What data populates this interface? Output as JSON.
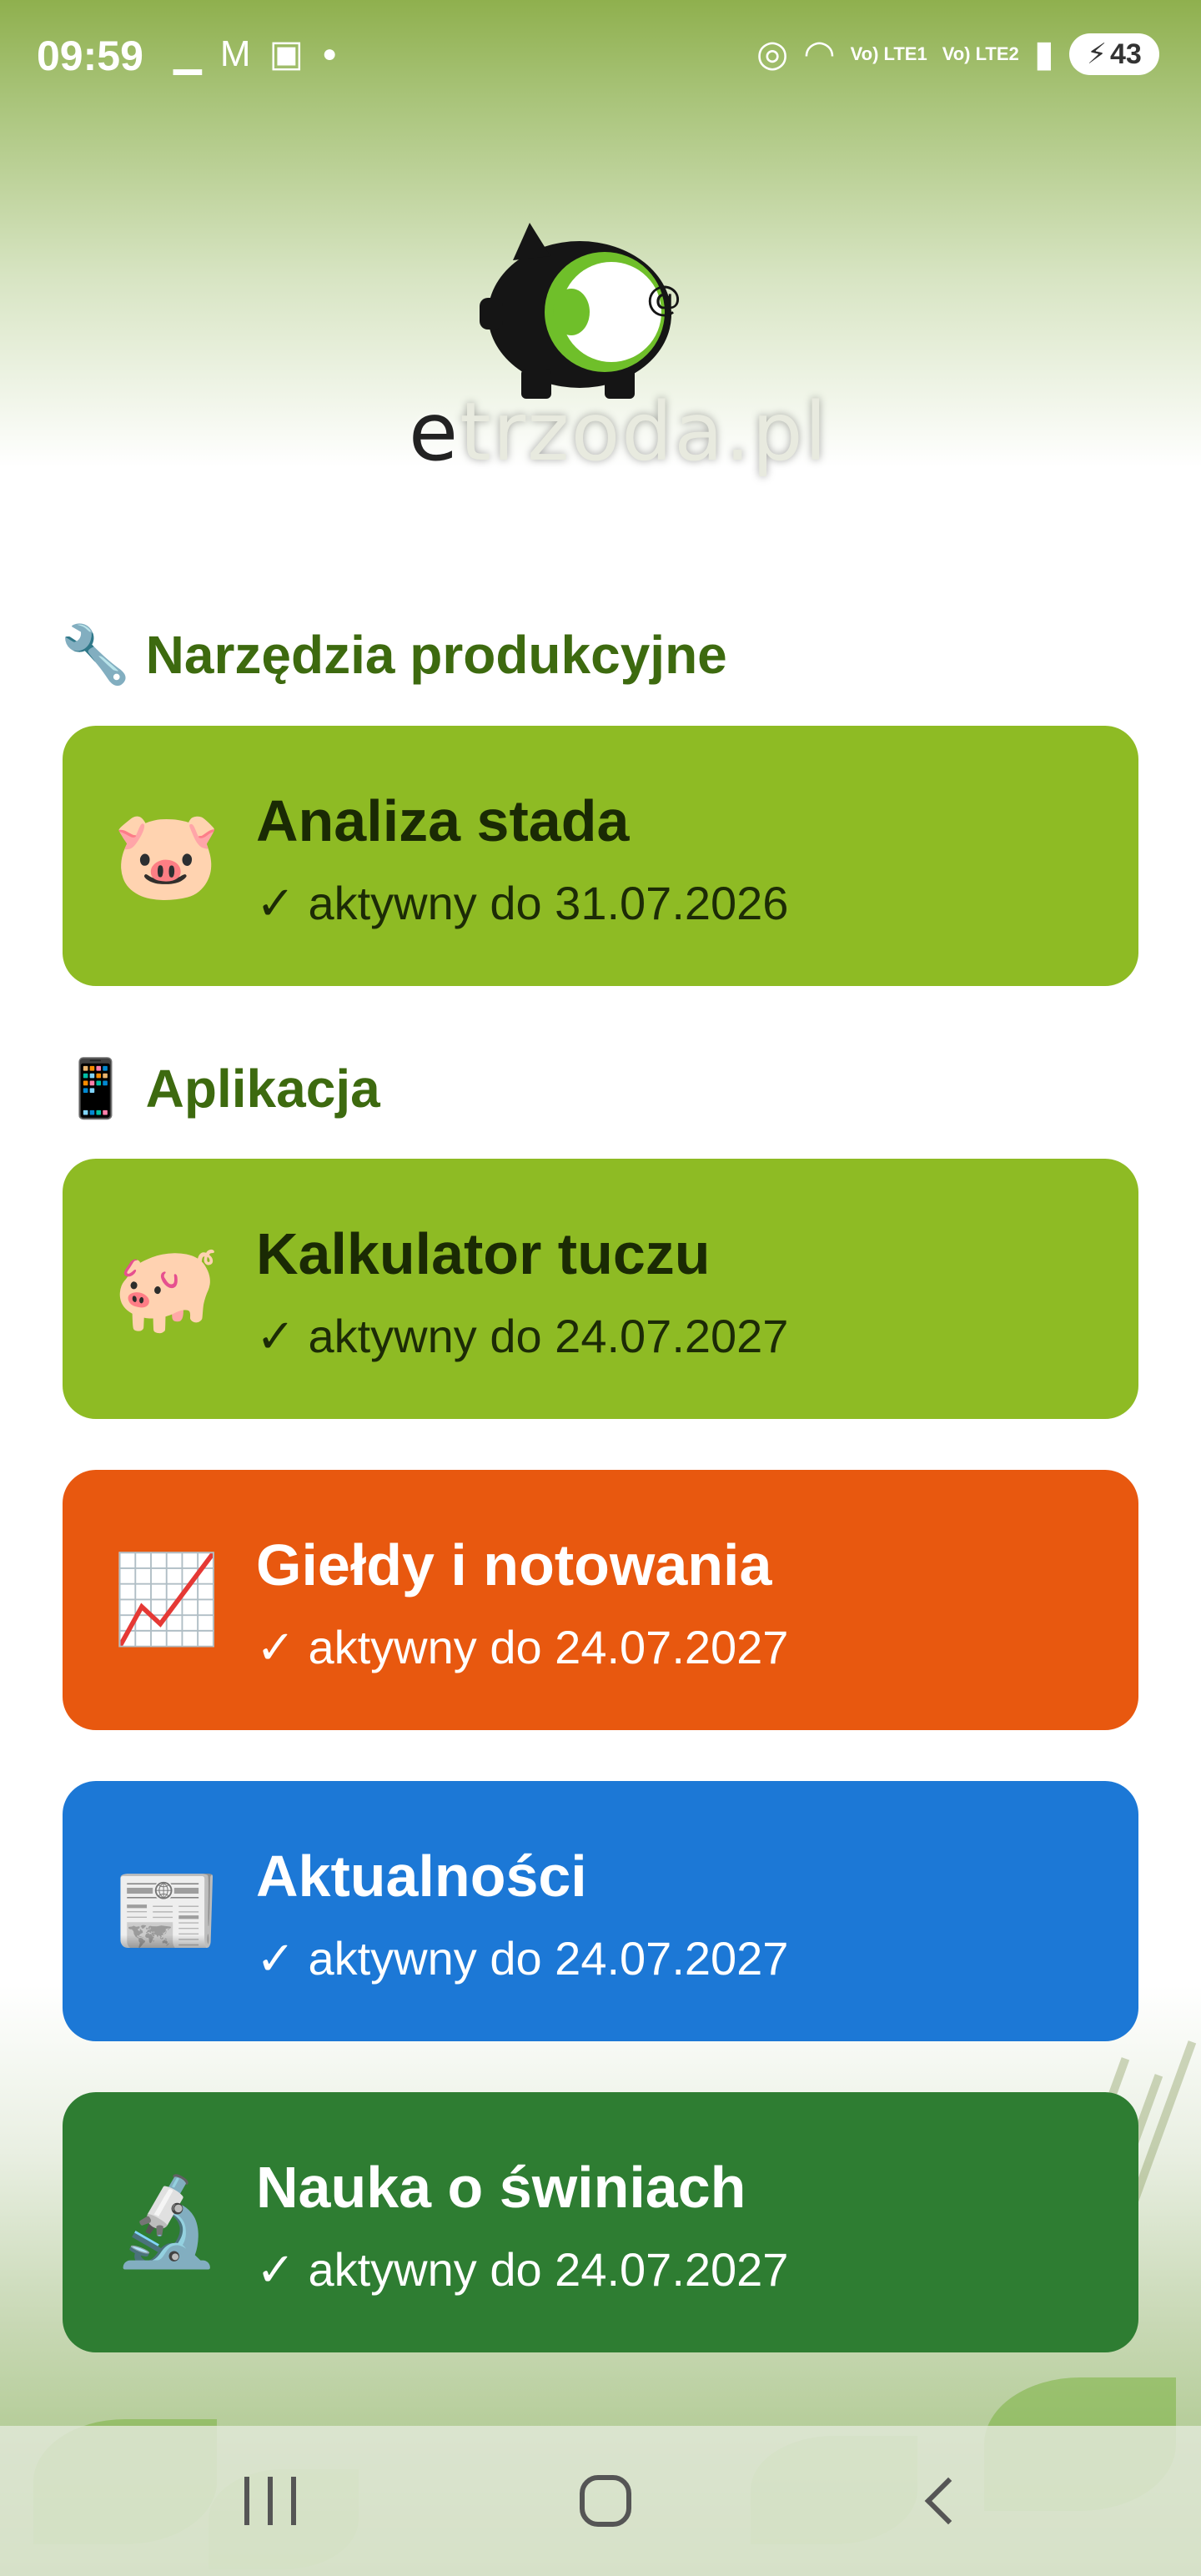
{
  "status_bar": {
    "time": "09:59",
    "left_icons": [
      "notification-icon",
      "gmail-icon",
      "device-icon",
      "dot-icon"
    ],
    "lte1": "Vo) LTE1",
    "lte2": "Vo) LTE2",
    "battery": "43"
  },
  "logo": {
    "text_e": "e",
    "text_rest": "trzoda.pl"
  },
  "sections": {
    "tools": {
      "emoji": "🔧",
      "title": "Narzędzia produkcyjne"
    },
    "apps": {
      "emoji": "📱",
      "title": "Aplikacja"
    }
  },
  "cards": [
    {
      "icon": "🐷",
      "icon_name": "pig-face-icon",
      "title": "Analiza stada",
      "status": "✓ aktywny do 31.07.2026",
      "color": "#8ebb24"
    },
    {
      "icon": "🐖",
      "icon_name": "pig-icon",
      "title": "Kalkulator tuczu",
      "status": "✓ aktywny do 24.07.2027",
      "color": "#8ebb24"
    },
    {
      "icon": "📈",
      "icon_name": "chart-up-icon",
      "title": "Giełdy i notowania",
      "status": "✓ aktywny do 24.07.2027",
      "color": "#e8580f"
    },
    {
      "icon": "📰",
      "icon_name": "newspaper-icon",
      "title": "Aktualności",
      "status": "✓ aktywny do 24.07.2027",
      "color": "#1c78d6"
    },
    {
      "icon": "🔬",
      "icon_name": "microscope-icon",
      "title": "Nauka o świniach",
      "status": "✓ aktywny do 24.07.2027",
      "color": "#2e7d32"
    }
  ],
  "nav": {
    "recents": "recents-icon",
    "home": "home-icon",
    "back": "back-icon"
  }
}
